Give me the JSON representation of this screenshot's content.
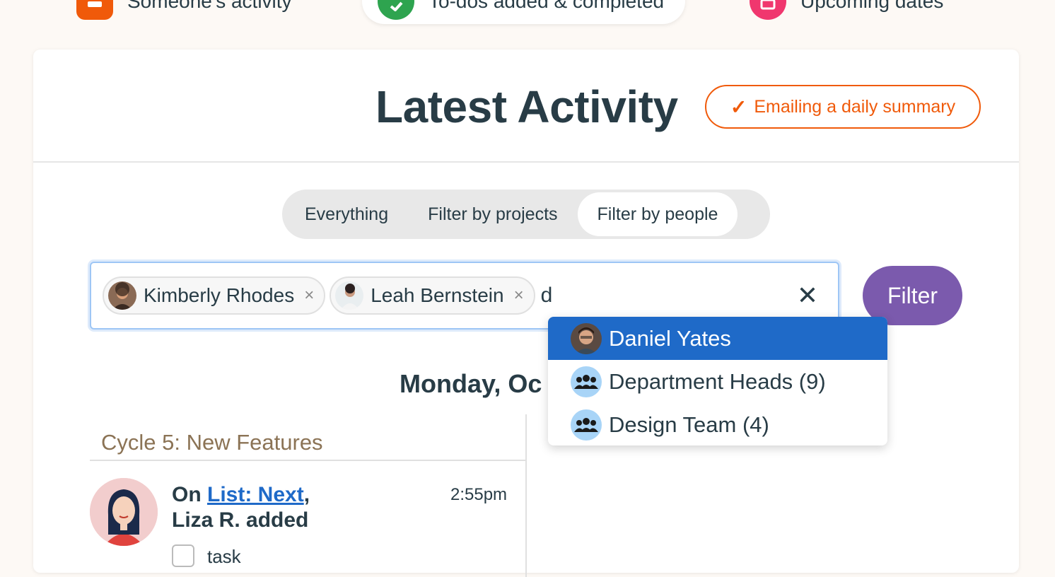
{
  "nav": {
    "items": [
      {
        "label": "Someone's activity",
        "icon": "person-icon",
        "color": "#f05a0a"
      },
      {
        "label": "To-dos added & completed",
        "icon": "check-icon",
        "color": "#2ea44f"
      },
      {
        "label": "Upcoming dates",
        "icon": "calendar-icon",
        "color": "#f0376e"
      }
    ]
  },
  "header": {
    "title": "Latest Activity",
    "summary_check": "✓",
    "summary_label": "Emailing a daily summary"
  },
  "tabs": [
    {
      "label": "Everything"
    },
    {
      "label": "Filter by projects"
    },
    {
      "label": "Filter by people",
      "selected": true
    }
  ],
  "filter": {
    "tokens": [
      {
        "name": "Kimberly Rhodes"
      },
      {
        "name": "Leah Bernstein"
      }
    ],
    "typed_value": "d",
    "clear_symbol": "✕",
    "remove_symbol": "×",
    "button_label": "Filter"
  },
  "dropdown": {
    "options": [
      {
        "label": "Daniel Yates",
        "type": "person",
        "highlighted": true
      },
      {
        "label": "Department Heads (9)",
        "type": "group"
      },
      {
        "label": "Design Team (4)",
        "type": "group"
      }
    ]
  },
  "feed": {
    "day_heading": "Monday, Oc",
    "project": "Cycle 5: New Features",
    "entry": {
      "prefix": "On ",
      "link": "List: Next",
      "suffix": ",",
      "actor_line": "Liza R. added",
      "time": "2:55pm",
      "task_label": "task"
    }
  },
  "colors": {
    "accent_orange": "#f05a0a",
    "filter_purple": "#7b5aad",
    "highlight_blue": "#1f6ac8",
    "project_brown": "#8b7355"
  }
}
